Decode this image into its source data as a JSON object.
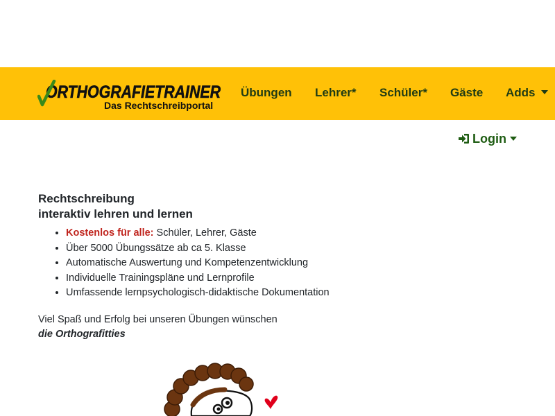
{
  "navbar": {
    "brand": {
      "logo_text": "ORTHOGRAFIETRAINER",
      "subtitle": "Das Rechtschreibportal"
    },
    "items": [
      {
        "label": "Übungen"
      },
      {
        "label": "Lehrer*"
      },
      {
        "label": "Schüler*"
      },
      {
        "label": "Gäste"
      },
      {
        "label": "Adds"
      }
    ],
    "colors": {
      "background": "#ffc107",
      "text": "#1f3b14",
      "logo_check": "#3a8a1a"
    }
  },
  "login": {
    "label": "Login",
    "icon": "sign-in-icon"
  },
  "main": {
    "heading_line1": "Rechtschreibung",
    "heading_line2": "interaktiv lehren und lernen",
    "features": [
      {
        "highlight": "Kostenlos für alle:",
        "text": " Schüler, Lehrer, Gäste"
      },
      {
        "text": "Über 5000 Übungssätze ab ca 5. Klasse"
      },
      {
        "text": "Automatische Auswertung und Kompetenzentwicklung"
      },
      {
        "text": "Individuelle Trainingspläne und Lernprofile"
      },
      {
        "text": "Umfassende lernpsychologisch-didaktische Dokumentation"
      }
    ],
    "greeting": "Viel Spaß und Erfolg bei unseren Übungen wünschen",
    "signature": "die Orthografitties"
  },
  "mascot": {
    "icon": "mascot-illustration",
    "heart_color": "#e0001b",
    "hair_color": "#6b3510"
  }
}
